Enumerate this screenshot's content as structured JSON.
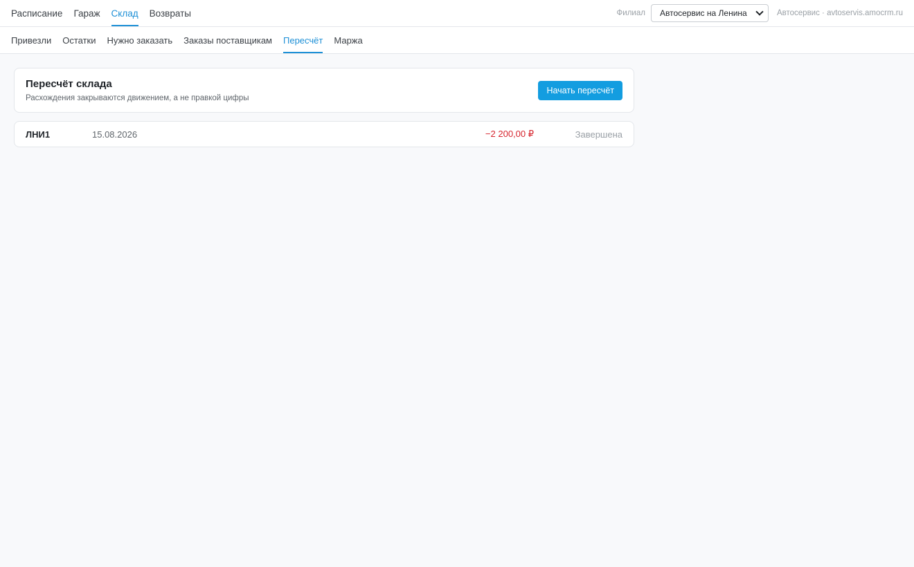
{
  "topnav": {
    "items": [
      {
        "label": "Расписание",
        "active": false
      },
      {
        "label": "Гараж",
        "active": false
      },
      {
        "label": "Склад",
        "active": true
      },
      {
        "label": "Возвраты",
        "active": false
      }
    ],
    "branch_label": "Филиал",
    "branch_value": "Автосервис на Ленина",
    "account": "Автосервис · avtoservis.amocrm.ru"
  },
  "subnav": {
    "items": [
      {
        "label": "Привезли",
        "active": false
      },
      {
        "label": "Остатки",
        "active": false
      },
      {
        "label": "Нужно заказать",
        "active": false
      },
      {
        "label": "Заказы поставщикам",
        "active": false
      },
      {
        "label": "Пересчёт",
        "active": true
      },
      {
        "label": "Маржа",
        "active": false
      }
    ]
  },
  "recount": {
    "title": "Пересчёт склада",
    "subtitle": "Расхождения закрываются движением, а не правкой цифры",
    "start_button": "Начать пересчёт",
    "records": [
      {
        "code": "ЛНИ1",
        "date": "15.08.2026",
        "amount": "−2 200,00 ₽",
        "status": "Завершена"
      }
    ]
  },
  "colors": {
    "accent": "#1c8fd6",
    "button": "#139de0",
    "negative": "#d6242d",
    "background": "#f8f9fb"
  }
}
